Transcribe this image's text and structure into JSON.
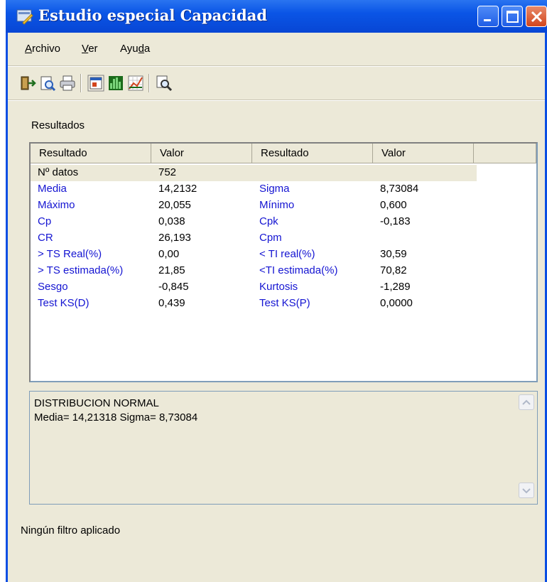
{
  "window": {
    "title": "Estudio especial Capacidad"
  },
  "menu": [
    {
      "label_first": "A",
      "label_rest": "rchivo"
    },
    {
      "label_first": "V",
      "label_rest": "er"
    },
    {
      "label_first": "Ayu",
      "label_u": "d",
      "label_rest": "a"
    }
  ],
  "toolbar": {
    "icons": [
      "exit-icon",
      "print-preview-icon",
      "print-icon",
      "properties-icon",
      "histogram-icon",
      "chart-icon",
      "zoom-icon"
    ]
  },
  "results": {
    "group_label": "Resultados",
    "columns": [
      "Resultado",
      "Valor",
      "Resultado",
      "Valor"
    ],
    "rows": [
      {
        "l1": "Nº datos",
        "v1": "752",
        "l2": "",
        "v2": ""
      },
      {
        "l1": "Media",
        "v1": "14,2132",
        "l2": "Sigma",
        "v2": "8,73084"
      },
      {
        "l1": "Máximo",
        "v1": "20,055",
        "l2": "Mínimo",
        "v2": "0,600"
      },
      {
        "l1": "Cp",
        "v1": "0,038",
        "l2": "Cpk",
        "v2": "-0,183"
      },
      {
        "l1": "CR",
        "v1": "26,193",
        "l2": "Cpm",
        "v2": ""
      },
      {
        "l1": "> TS Real(%)",
        "v1": "0,00",
        "l2": "< TI real(%)",
        "v2": "30,59"
      },
      {
        "l1": "> TS estimada(%)",
        "v1": "21,85",
        "l2": "<TI estimada(%)",
        "v2": "70,82"
      },
      {
        "l1": "Sesgo",
        "v1": "-0,845",
        "l2": "Kurtosis",
        "v2": "-1,289"
      },
      {
        "l1": "Test KS(D)",
        "v1": "0,439",
        "l2": "Test KS(P)",
        "v2": "0,0000"
      }
    ]
  },
  "distribution": {
    "line1": "DISTRIBUCION NORMAL",
    "line2": "Media= 14,21318 Sigma= 8,73084"
  },
  "status": {
    "text": "Ningún filtro aplicado"
  },
  "colors": {
    "title_bar": "#0a55e6",
    "label_text": "#1414d2",
    "window_bg": "#ece9d8"
  }
}
